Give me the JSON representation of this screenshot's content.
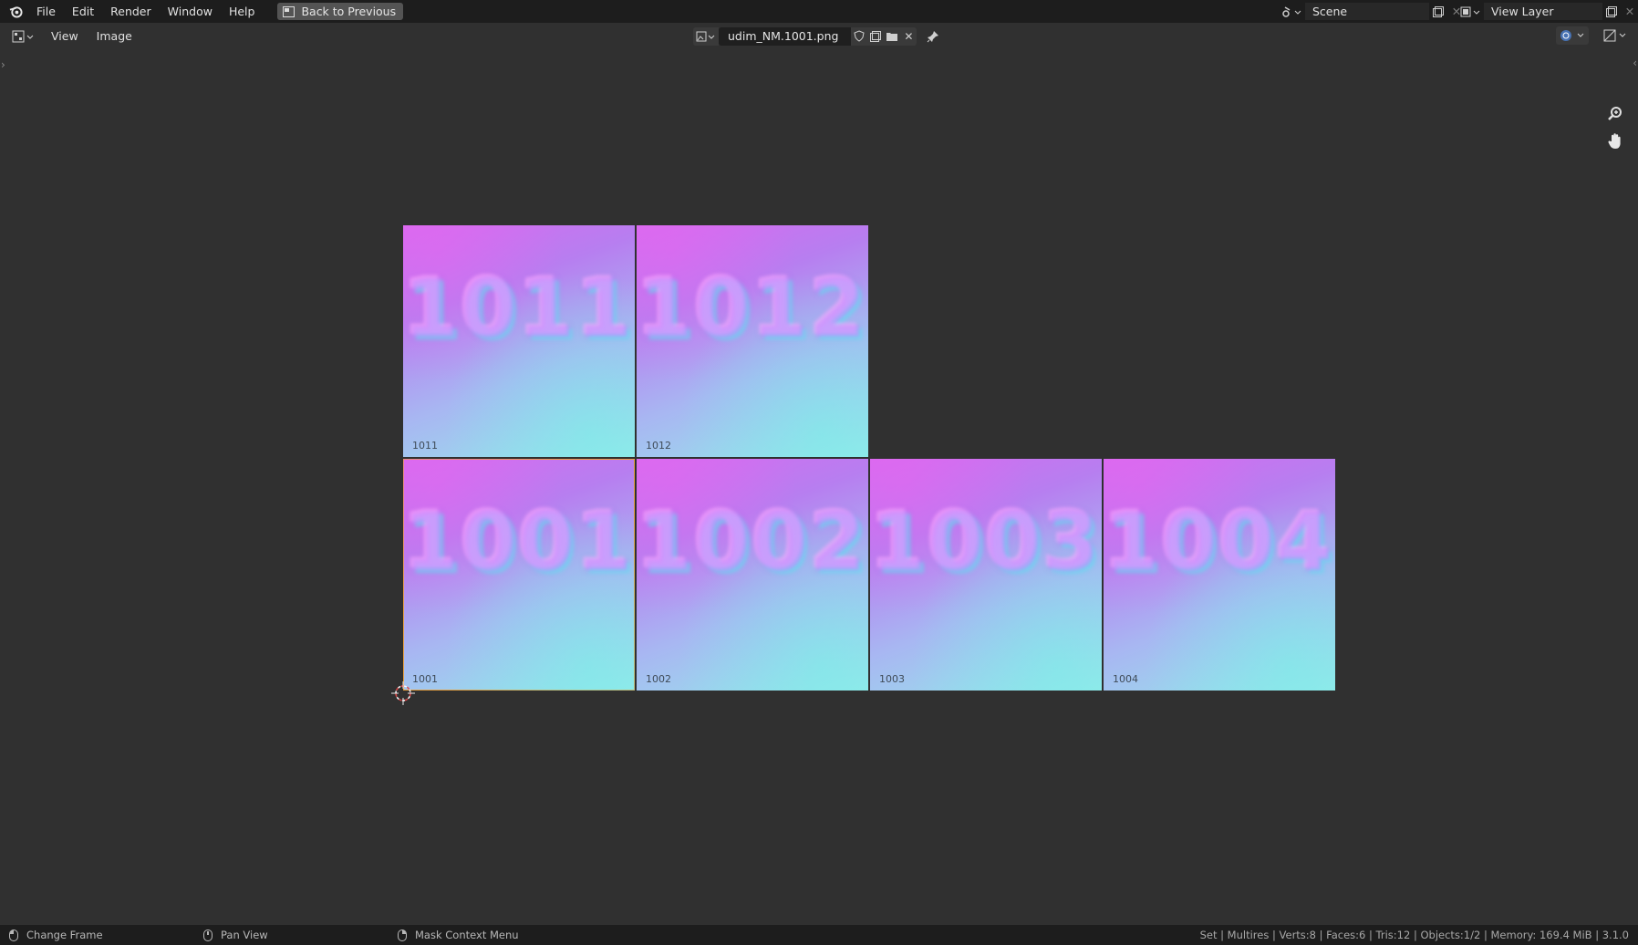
{
  "topbar": {
    "menus": [
      "File",
      "Edit",
      "Render",
      "Window",
      "Help"
    ],
    "back_button": "Back to Previous",
    "scene_field": "Scene",
    "view_layer_field": "View Layer"
  },
  "header": {
    "menus": [
      "View",
      "Image"
    ],
    "image_name": "udim_NM.1001.png"
  },
  "tiles": [
    {
      "label": "1011",
      "art": "1011"
    },
    {
      "label": "1012",
      "art": "1012"
    },
    {
      "label": "1001",
      "art": "1001"
    },
    {
      "label": "1002",
      "art": "1002"
    },
    {
      "label": "1003",
      "art": "1003"
    },
    {
      "label": "1004",
      "art": "1004"
    }
  ],
  "statusbar": {
    "left_click": "Change Frame",
    "middle_click": "Pan View",
    "right_click": "Mask Context Menu",
    "stats": "Set | Multires | Verts:8 | Faces:6 | Tris:12 | Objects:1/2 | Memory: 169.4 MiB | 3.1.0"
  },
  "icons": {
    "blender": "blender-logo-icon",
    "back": "back-to-previous-icon",
    "scene": "scene-icon",
    "view_layer": "view-layer-icon",
    "editor_type": "image-editor-type-icon",
    "zoom": "zoom-icon",
    "pan": "hand-pan-icon",
    "cursor": "2d-cursor-icon"
  }
}
